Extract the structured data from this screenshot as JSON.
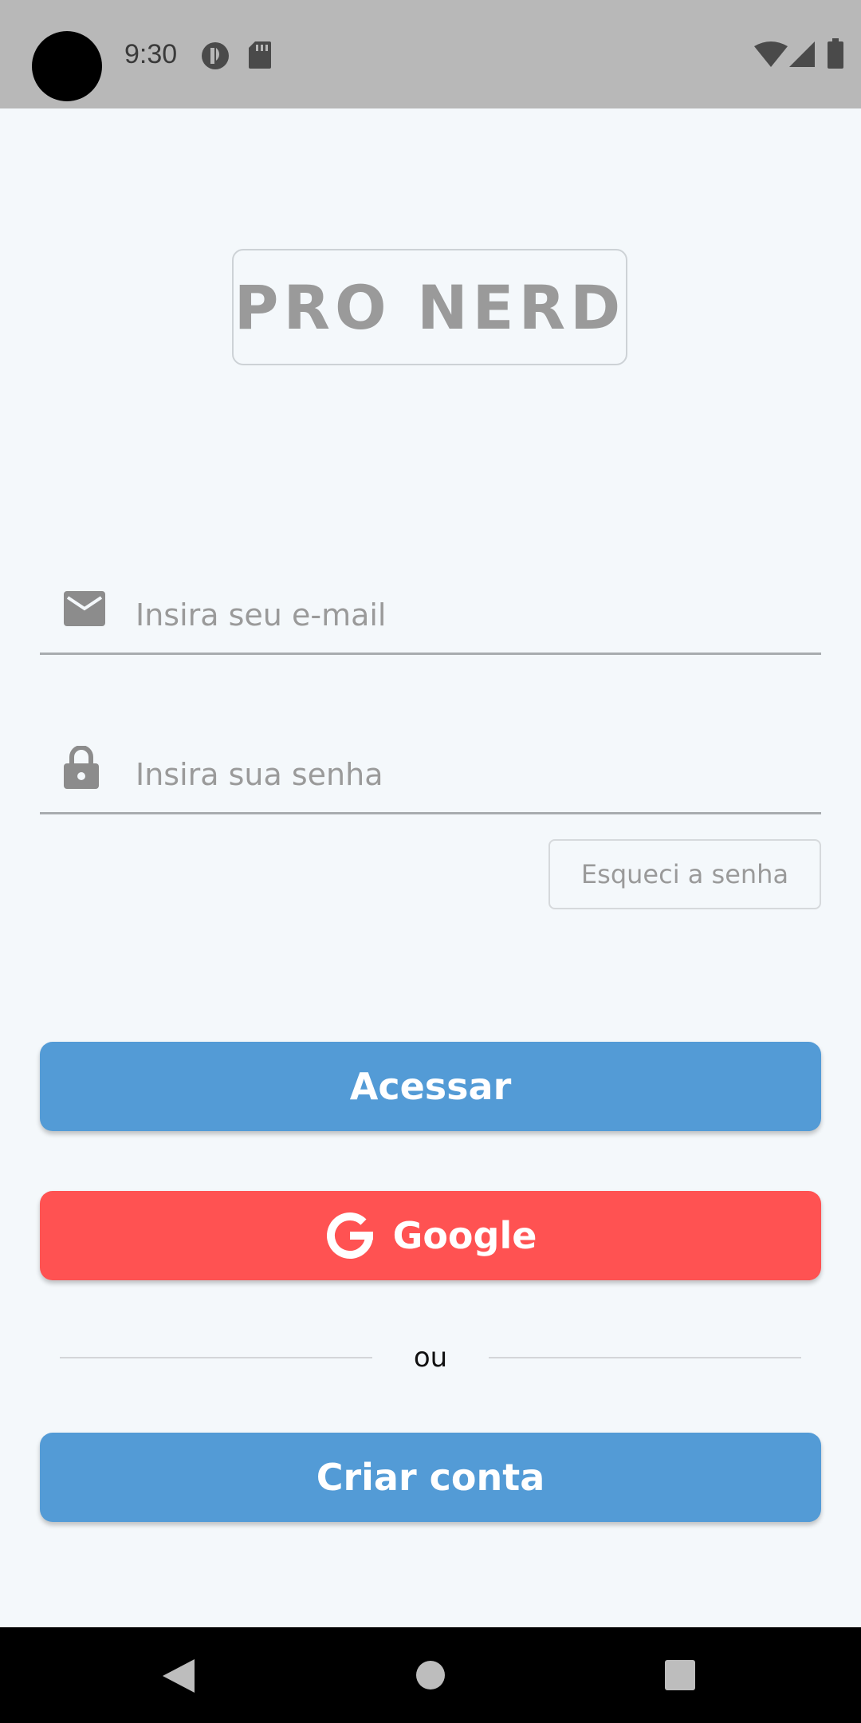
{
  "status_bar": {
    "time": "9:30"
  },
  "logo": {
    "text": "PRO NERD"
  },
  "email_field": {
    "placeholder": "Insira seu e-mail",
    "icon": "mail-icon"
  },
  "password_field": {
    "placeholder": "Insira sua senha",
    "icon": "lock-icon"
  },
  "forgot_password": {
    "label": "Esqueci a senha"
  },
  "buttons": {
    "login_label": "Acessar",
    "google_label": "Google",
    "create_account_label": "Criar conta"
  },
  "divider": {
    "text": "ou"
  },
  "colors": {
    "primary": "#539bd6",
    "google": "#ff5252",
    "background": "#f4f8fb",
    "status_bar": "#b8b8b8"
  }
}
